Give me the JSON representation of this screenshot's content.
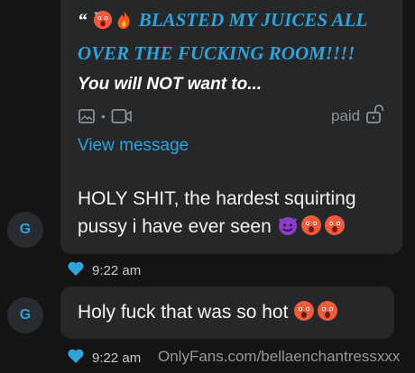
{
  "conversation": {
    "locked_message": {
      "open_quote": "“",
      "headline": "BLASTED MY JUICES ALL OVER THE FUCKING ROOM!!!!",
      "teaser": "You will NOT want to...",
      "media_separator": "•",
      "price_label": "paid",
      "view_message_label": "View message",
      "emojis": [
        "hot-face-emoji",
        "fire-emoji"
      ],
      "icons": [
        "image-icon",
        "video-icon",
        "lock-icon"
      ]
    },
    "messages": [
      {
        "avatar_initial": "G",
        "text": "HOLY SHIT, the hardest squirting pussy i have ever seen",
        "emojis": [
          "smiling-devil-emoji",
          "hot-face-emoji",
          "hot-face-emoji"
        ],
        "time": "9:22 am",
        "liked": true
      },
      {
        "avatar_initial": "G",
        "text": "Holy fuck that was so hot",
        "emojis": [
          "hot-face-emoji",
          "hot-face-emoji"
        ],
        "time": "9:22 am",
        "liked": true
      }
    ],
    "watermark": "OnlyFans.com/bellaenchantressxxx"
  },
  "colors": {
    "background": "#141414",
    "bubble": "#252729",
    "accent": "#2fa3da",
    "muted": "#8e9399"
  }
}
